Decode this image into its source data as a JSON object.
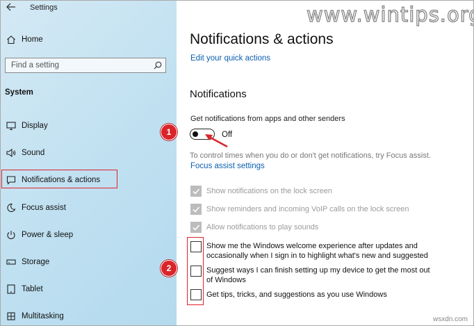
{
  "window": {
    "title": "Settings"
  },
  "watermark": "www.wintips.org",
  "footer": "wsxdn.com",
  "sidebar": {
    "home": "Home",
    "search_placeholder": "Find a setting",
    "section": "System",
    "items": [
      {
        "label": "Display",
        "icon": "monitor-icon"
      },
      {
        "label": "Sound",
        "icon": "speaker-icon"
      },
      {
        "label": "Notifications & actions",
        "icon": "notification-icon",
        "selected": true
      },
      {
        "label": "Focus assist",
        "icon": "moon-icon"
      },
      {
        "label": "Power & sleep",
        "icon": "power-icon"
      },
      {
        "label": "Storage",
        "icon": "storage-icon"
      },
      {
        "label": "Tablet",
        "icon": "tablet-icon"
      },
      {
        "label": "Multitasking",
        "icon": "multitasking-icon"
      }
    ]
  },
  "main": {
    "title": "Notifications & actions",
    "edit_quick_actions": "Edit your quick actions",
    "section": "Notifications",
    "toggle_label": "Get notifications from apps and other senders",
    "toggle_state": "Off",
    "focus_hint": "To control times when you do or don't get notifications, try Focus assist.",
    "focus_link": "Focus assist settings",
    "options": [
      {
        "label": "Show notifications on the lock screen",
        "checked": true,
        "enabled": false
      },
      {
        "label": "Show reminders and incoming VoIP calls on the lock screen",
        "checked": true,
        "enabled": false
      },
      {
        "label": "Allow notifications to play sounds",
        "checked": true,
        "enabled": false
      },
      {
        "label_line1": "Show me the Windows welcome experience after updates and",
        "label_line2": "occasionally when I sign in to highlight what's new and suggested",
        "checked": false,
        "enabled": true
      },
      {
        "label_line1": "Suggest ways I can finish setting up my device to get the most out",
        "label_line2": "of Windows",
        "checked": false,
        "enabled": true
      },
      {
        "label": "Get tips, tricks, and suggestions as you use Windows",
        "checked": false,
        "enabled": true
      }
    ]
  },
  "callouts": {
    "one": "1",
    "two": "2"
  },
  "colors": {
    "accent_link": "#0a5fb0",
    "highlight": "#e0202a",
    "badge": "#d9252a"
  }
}
